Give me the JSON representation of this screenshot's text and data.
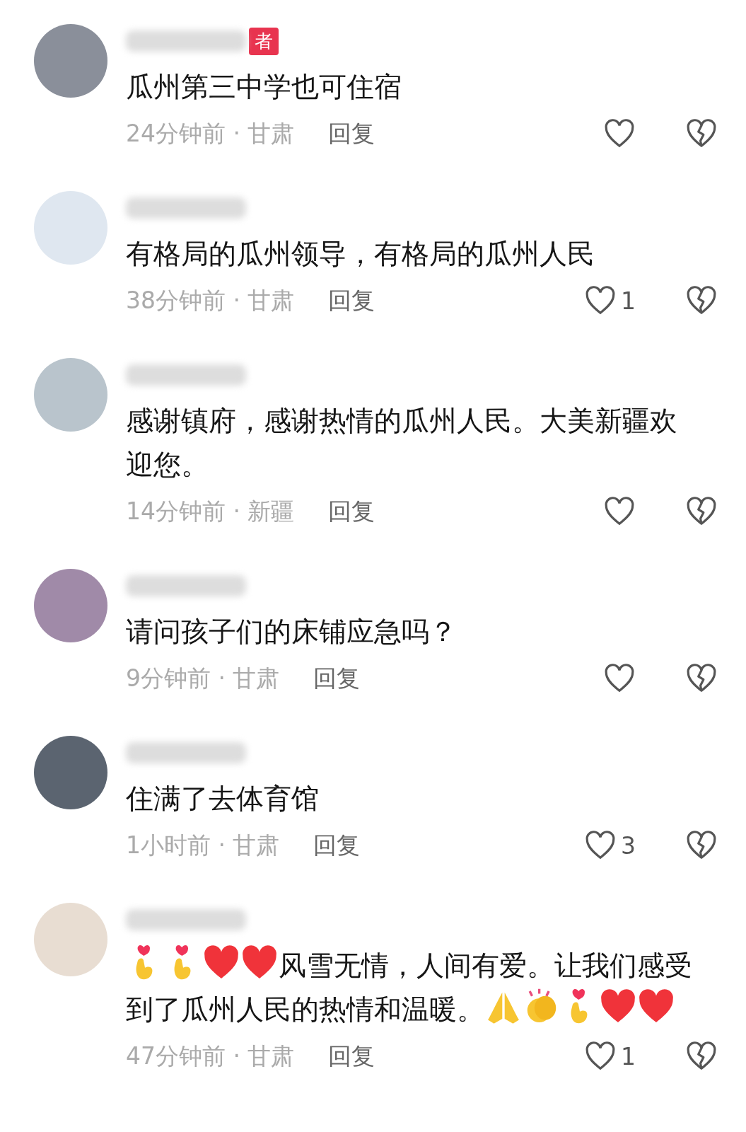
{
  "comments": [
    {
      "author_badge": "者",
      "text": [
        {
          "kind": "text",
          "text": "瓜州第三中学也可住宿"
        }
      ],
      "time": "24分钟前 · 甘肃",
      "reply": "回复"
    },
    {
      "text": [
        {
          "kind": "text",
          "text": "有格局的瓜州领导，有格局的瓜州人民"
        }
      ],
      "time": "38分钟前 · 甘肃",
      "reply": "回复",
      "likes": "1"
    },
    {
      "text": [
        {
          "kind": "text",
          "text": "感谢镇府，感谢热情的瓜州人民。大美新疆欢迎您。"
        }
      ],
      "time": "14分钟前 · 新疆",
      "reply": "回复"
    },
    {
      "text": [
        {
          "kind": "text",
          "text": "请问孩子们的床铺应急吗？"
        }
      ],
      "time": "9分钟前 · 甘肃",
      "reply": "回复"
    },
    {
      "text": [
        {
          "kind": "text",
          "text": "住满了去体育馆"
        }
      ],
      "time": "1小时前 · 甘肃",
      "reply": "回复",
      "likes": "3"
    },
    {
      "text": [
        {
          "kind": "finger-heart"
        },
        {
          "kind": "finger-heart"
        },
        {
          "kind": "heart"
        },
        {
          "kind": "heart"
        },
        {
          "kind": "text",
          "text": "风雪无情，人间有爱。让我们感受到了瓜州人民的热情和温暖。"
        },
        {
          "kind": "pray"
        },
        {
          "kind": "clap"
        },
        {
          "kind": "finger-heart"
        },
        {
          "kind": "heart"
        },
        {
          "kind": "heart"
        }
      ],
      "time": "47分钟前 · 甘肃",
      "reply": "回复",
      "likes": "1"
    }
  ]
}
